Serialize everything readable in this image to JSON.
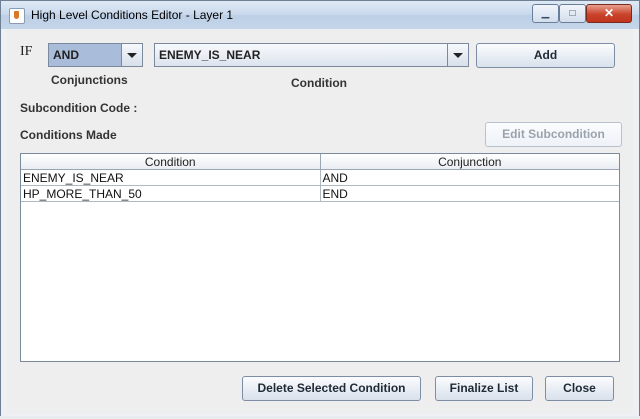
{
  "window": {
    "title": "High Level Conditions Editor - Layer 1",
    "controls": [
      "minimize",
      "maximize",
      "close"
    ]
  },
  "form": {
    "if_label": "IF",
    "conjunction": {
      "value": "AND",
      "label": "Conjunctions"
    },
    "condition": {
      "value": "ENEMY_IS_NEAR",
      "label": "Condition"
    },
    "add_label": "Add",
    "subcondition_code_label": "Subcondition Code :",
    "conditions_made_label": "Conditions Made",
    "edit_subcondition_label": "Edit Subcondition"
  },
  "table": {
    "headers": [
      "Condition",
      "Conjunction"
    ],
    "rows": [
      [
        "ENEMY_IS_NEAR",
        "AND"
      ],
      [
        "HP_MORE_THAN_50",
        "END"
      ]
    ]
  },
  "footer": {
    "delete_label": "Delete Selected Condition",
    "finalize_label": "Finalize List",
    "close_label": "Close"
  },
  "colors": {
    "conjunction_highlight": "#a9bcda",
    "titlebar": "#c9d9ec"
  }
}
